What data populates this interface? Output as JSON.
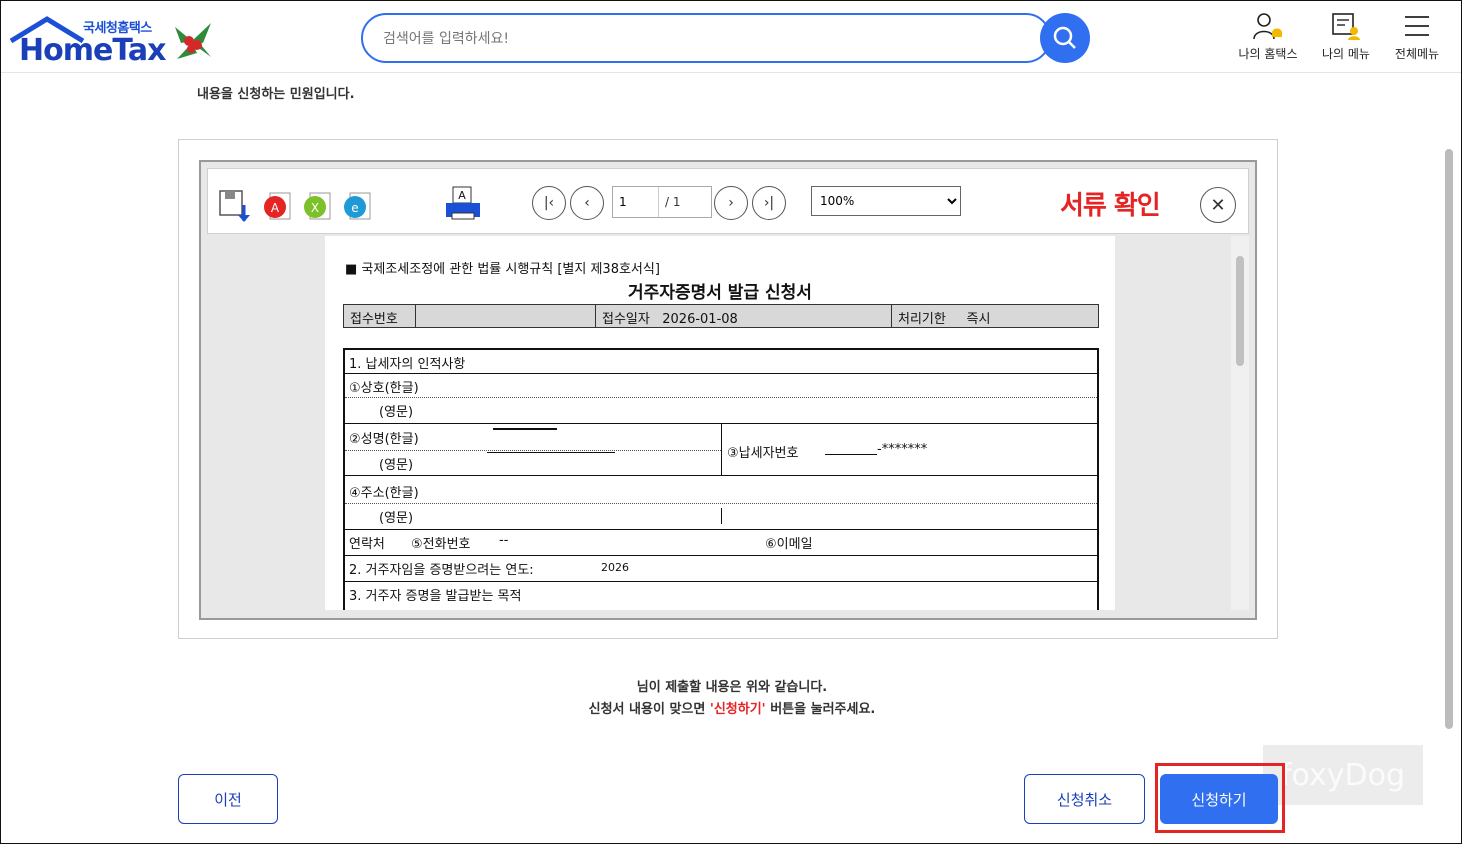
{
  "header": {
    "logo_kr": "국세청홈택스",
    "logo_en": "HomeTax",
    "search_placeholder": "검색어를 입력하세요!",
    "menus": [
      {
        "label": "나의 홈택스",
        "icon": "user-bell-icon"
      },
      {
        "label": "나의 메뉴",
        "icon": "menu-user-icon"
      },
      {
        "label": "전체메뉴",
        "icon": "hamburger-icon"
      }
    ]
  },
  "intro_text": "내용을 신청하는 민원입니다.",
  "viewer": {
    "page_current": "1",
    "page_total": "/ 1",
    "zoom": "100%",
    "zoom_options": [
      "100%"
    ],
    "label": "서류 확인"
  },
  "document": {
    "form_header": "■ 국제조세조정에 관한 법률 시행규칙 [별지 제38호서식]",
    "title": "거주자증명서 발급 신청서",
    "receipt_no_label": "접수번호",
    "receipt_date_label": "접수일자",
    "receipt_date": "2026-01-08",
    "processing_label": "처리기한",
    "processing_value": "즉시",
    "section1": "1. 납세자의 인적사항",
    "company_kr": "①상호(한글)",
    "english_1": "(영문)",
    "name_kr": "②성명(한글)",
    "english_2": "(영문)",
    "taxpayer_no_label": "③납세자번호",
    "taxpayer_no_value": "-*******",
    "address_kr": "④주소(한글)",
    "english_3": "(영문)",
    "contact_label": "연락처",
    "phone_label": "⑤전화번호",
    "phone_value": "--",
    "email_label": "⑥이메일",
    "section2": "2. 거주자임을 증명받으려는 연도:",
    "year_value": "2026",
    "section3": "3. 거주자 증명을 발급받는 목적"
  },
  "notice": {
    "line1": "님이 제출할 내용은 위와 같습니다.",
    "line2_prefix": "신청서 내용이 맞으면 ",
    "line2_em": "'신청하기'",
    "line2_suffix": " 버튼을 눌러주세요."
  },
  "buttons": {
    "prev": "이전",
    "cancel": "신청취소",
    "submit": "신청하기"
  },
  "watermark": "foxyDog",
  "colors": {
    "primary": "#2f6ff0",
    "accent_red": "#e52424",
    "navy": "#1a3fb8"
  }
}
